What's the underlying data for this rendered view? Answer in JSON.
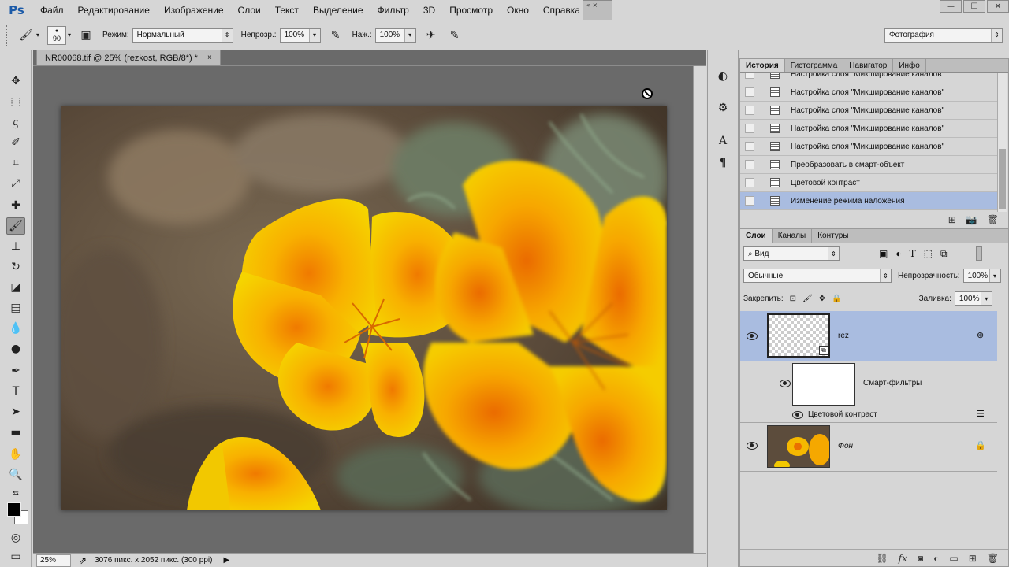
{
  "app": {
    "logo": "Ps"
  },
  "menu": [
    "Файл",
    "Редактирование",
    "Изображение",
    "Слои",
    "Текст",
    "Выделение",
    "Фильтр",
    "3D",
    "Просмотр",
    "Окно",
    "Справка"
  ],
  "options": {
    "brush_size": "90",
    "mode_label": "Режим:",
    "mode_value": "Нормальный",
    "opacity_label": "Непрозр.:",
    "opacity_value": "100%",
    "flow_label": "Наж.:",
    "flow_value": "100%",
    "workspace": "Фотография"
  },
  "document": {
    "tab_title": "NR00068.tif @ 25% (rezkost, RGB/8*) *",
    "close": "×",
    "zoom": "25%",
    "info": "3076 пикс. x 2052 пикс. (300 ppi)"
  },
  "history": {
    "tabs": [
      "История",
      "Гистограмма",
      "Навигатор",
      "Инфо"
    ],
    "items": [
      "Настройка слоя \"Микширование каналов\"",
      "Настройка слоя \"Микширование каналов\"",
      "Настройка слоя \"Микширование каналов\"",
      "Настройка слоя \"Микширование каналов\"",
      "Настройка слоя \"Микширование каналов\"",
      "Преобразовать в смарт-объект",
      "Цветовой контраст",
      "Изменение режима наложения"
    ],
    "selected_index": 7
  },
  "layers": {
    "tabs": [
      "Слои",
      "Каналы",
      "Контуры"
    ],
    "filter_kind": "Вид",
    "blend_mode": "Обычные",
    "opacity_label": "Непрозрачность:",
    "opacity_value": "100%",
    "lock_label": "Закрепить:",
    "fill_label": "Заливка:",
    "fill_value": "100%",
    "items": [
      {
        "name": "rez",
        "type": "smart-object",
        "selected": true
      },
      {
        "name": "Смарт-фильтры",
        "type": "smart-filters"
      },
      {
        "name": "Цветовой контраст",
        "type": "filter"
      },
      {
        "name": "Фон",
        "type": "background",
        "locked": true
      }
    ]
  },
  "colors": {
    "accent": "#a9bce0",
    "fg": "#000000",
    "bg": "#ffffff"
  }
}
